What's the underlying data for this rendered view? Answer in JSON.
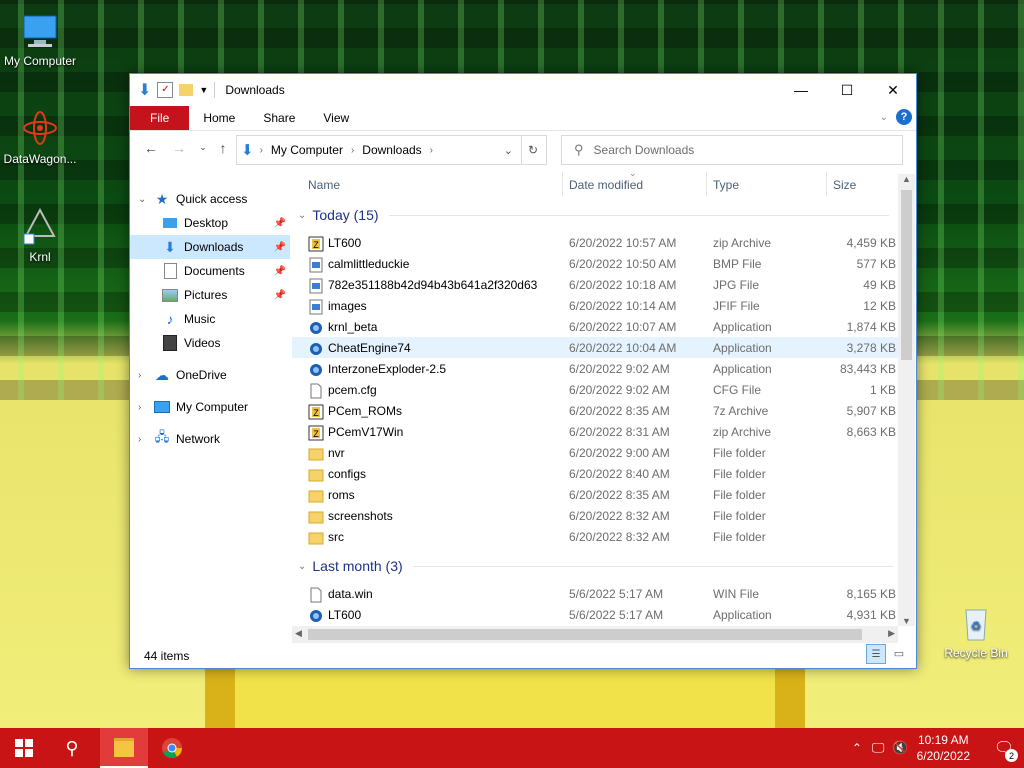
{
  "desktop": {
    "icons": [
      {
        "label": "My Computer"
      },
      {
        "label": "DataWagon..."
      },
      {
        "label": "Krnl"
      },
      {
        "label": "Recycle Bin"
      }
    ]
  },
  "window": {
    "title": "Downloads",
    "ribbon_tabs": [
      "File",
      "Home",
      "Share",
      "View"
    ],
    "breadcrumb": [
      "My Computer",
      "Downloads"
    ],
    "search_placeholder": "Search Downloads",
    "nav_items": [
      {
        "label": "Quick access",
        "icon": "star-icon",
        "pinned": false,
        "expanded": true
      },
      {
        "label": "Desktop",
        "icon": "desktop-icon",
        "pinned": true
      },
      {
        "label": "Downloads",
        "icon": "download-icon",
        "pinned": true,
        "selected": true
      },
      {
        "label": "Documents",
        "icon": "document-icon",
        "pinned": true
      },
      {
        "label": "Pictures",
        "icon": "pictures-icon",
        "pinned": true
      },
      {
        "label": "Music",
        "icon": "music-icon",
        "pinned": false
      },
      {
        "label": "Videos",
        "icon": "videos-icon",
        "pinned": false
      },
      {
        "label": "OneDrive",
        "icon": "cloud-icon",
        "pinned": false
      },
      {
        "label": "My Computer",
        "icon": "computer-icon",
        "pinned": false
      },
      {
        "label": "Network",
        "icon": "network-icon",
        "pinned": false
      }
    ],
    "columns": {
      "name": "Name",
      "date": "Date modified",
      "type": "Type",
      "size": "Size"
    },
    "groups": [
      {
        "label": "Today (15)",
        "rows": [
          {
            "name": "LT600",
            "date": "6/20/2022 10:57 AM",
            "type": "zip Archive",
            "size": "4,459 KB",
            "icon": "archive"
          },
          {
            "name": "calmlittleduckie",
            "date": "6/20/2022 10:50 AM",
            "type": "BMP File",
            "size": "577 KB",
            "icon": "image"
          },
          {
            "name": "782e351188b42d94b43b641a2f320d63",
            "date": "6/20/2022 10:18 AM",
            "type": "JPG File",
            "size": "49 KB",
            "icon": "image"
          },
          {
            "name": "images",
            "date": "6/20/2022 10:14 AM",
            "type": "JFIF File",
            "size": "12 KB",
            "icon": "image"
          },
          {
            "name": "krnl_beta",
            "date": "6/20/2022 10:07 AM",
            "type": "Application",
            "size": "1,874 KB",
            "icon": "app"
          },
          {
            "name": "CheatEngine74",
            "date": "6/20/2022 10:04 AM",
            "type": "Application",
            "size": "3,278 KB",
            "icon": "app",
            "highlight": true
          },
          {
            "name": "InterzoneExploder-2.5",
            "date": "6/20/2022 9:02 AM",
            "type": "Application",
            "size": "83,443 KB",
            "icon": "app"
          },
          {
            "name": "pcem.cfg",
            "date": "6/20/2022 9:02 AM",
            "type": "CFG File",
            "size": "1 KB",
            "icon": "file"
          },
          {
            "name": "PCem_ROMs",
            "date": "6/20/2022 8:35 AM",
            "type": "7z Archive",
            "size": "5,907 KB",
            "icon": "archive"
          },
          {
            "name": "PCemV17Win",
            "date": "6/20/2022 8:31 AM",
            "type": "zip Archive",
            "size": "8,663 KB",
            "icon": "archive"
          },
          {
            "name": "nvr",
            "date": "6/20/2022 9:00 AM",
            "type": "File folder",
            "size": "",
            "icon": "folder"
          },
          {
            "name": "configs",
            "date": "6/20/2022 8:40 AM",
            "type": "File folder",
            "size": "",
            "icon": "folder"
          },
          {
            "name": "roms",
            "date": "6/20/2022 8:35 AM",
            "type": "File folder",
            "size": "",
            "icon": "folder"
          },
          {
            "name": "screenshots",
            "date": "6/20/2022 8:32 AM",
            "type": "File folder",
            "size": "",
            "icon": "folder"
          },
          {
            "name": "src",
            "date": "6/20/2022 8:32 AM",
            "type": "File folder",
            "size": "",
            "icon": "folder"
          }
        ]
      },
      {
        "label": "Last month (3)",
        "rows": [
          {
            "name": "data.win",
            "date": "5/6/2022 5:17 AM",
            "type": "WIN File",
            "size": "8,165 KB",
            "icon": "file"
          },
          {
            "name": "LT600",
            "date": "5/6/2022 5:17 AM",
            "type": "Application",
            "size": "4,931 KB",
            "icon": "app"
          }
        ]
      }
    ],
    "status_text": "44 items"
  },
  "taskbar": {
    "time": "10:19 AM",
    "date": "6/20/2022",
    "notification_count": "2"
  },
  "colors": {
    "accent": "#0078d7",
    "file_tab": "#c4131c",
    "taskbar": "#c81414",
    "selection": "#cce8ff"
  }
}
